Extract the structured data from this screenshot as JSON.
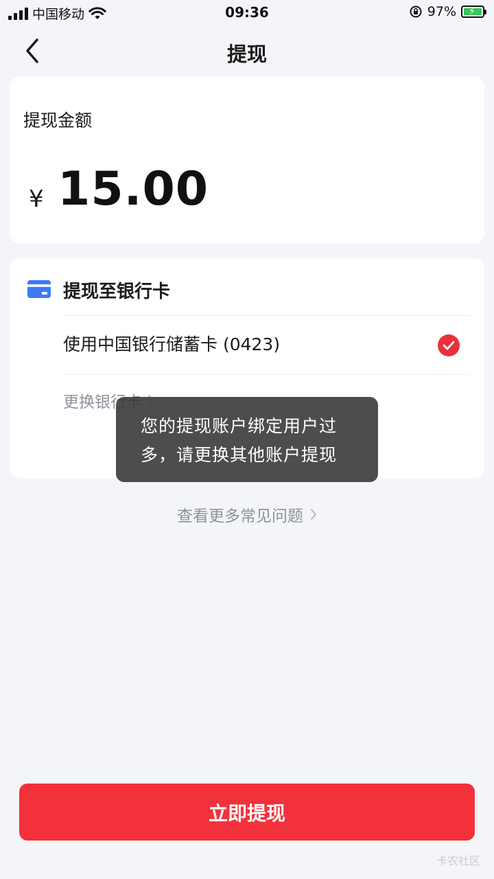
{
  "status_bar": {
    "carrier": "中国移动",
    "time": "09:36",
    "battery": "97%"
  },
  "nav": {
    "title": "提现"
  },
  "amount_card": {
    "label": "提现金额",
    "currency": "¥",
    "amount": "15.00"
  },
  "bank_card": {
    "title": "提现至银行卡",
    "selected_card": "使用中国银行储蓄卡 (0423)",
    "change_label": "更换银行卡"
  },
  "faq": {
    "label": "查看更多常见问题"
  },
  "toast": {
    "message": "您的提现账户绑定用户过多，请更换其他账户提现"
  },
  "submit": {
    "label": "立即提现"
  },
  "watermark": {
    "text": "卡农社区"
  },
  "colors": {
    "accent_red": "#f2313b",
    "bank_icon_blue": "#3d7bf2",
    "battery_green": "#34c759"
  }
}
